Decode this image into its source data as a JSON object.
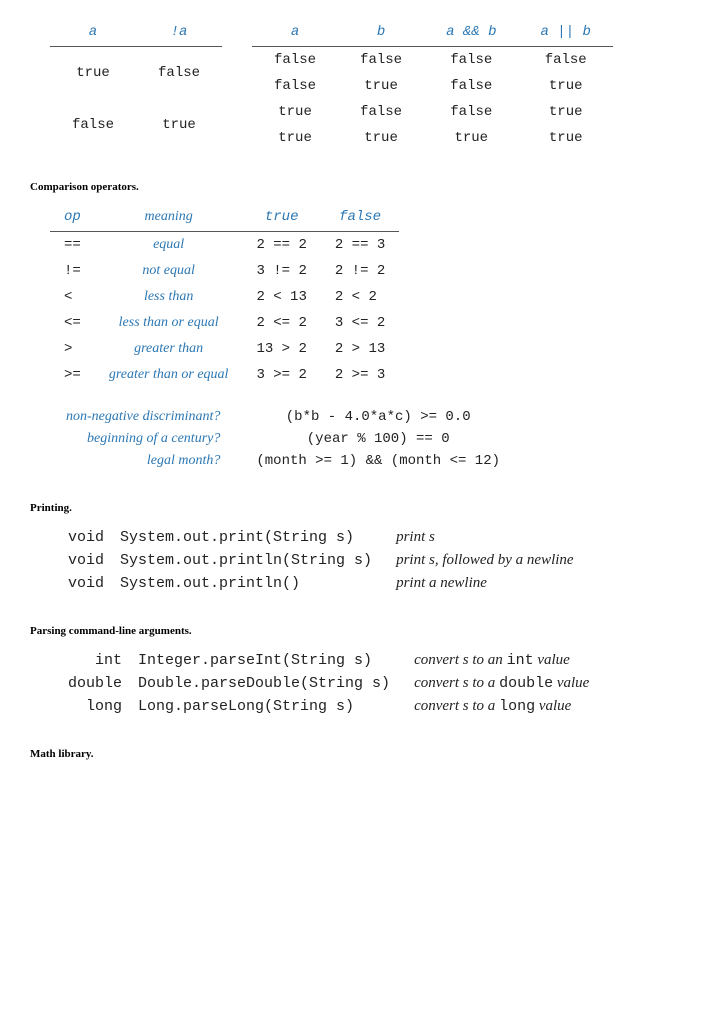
{
  "truth_not": {
    "headers": [
      "a",
      "!a"
    ],
    "rows": [
      [
        "true",
        "false"
      ],
      [
        "false",
        "true"
      ]
    ]
  },
  "truth_andor": {
    "headers": [
      "a",
      "b",
      "a && b",
      "a || b"
    ],
    "rows": [
      [
        "false",
        "false",
        "false",
        "false"
      ],
      [
        "false",
        "true",
        "false",
        "true"
      ],
      [
        "true",
        "false",
        "false",
        "true"
      ],
      [
        "true",
        "true",
        "true",
        "true"
      ]
    ]
  },
  "sections": {
    "comparison": "Comparison operators.",
    "printing": "Printing.",
    "parsing": "Parsing command-line arguments.",
    "math": "Math library."
  },
  "cmp": {
    "headers": {
      "op": "op",
      "meaning": "meaning",
      "true": "true",
      "false": "false"
    },
    "rows": [
      {
        "op": "==",
        "meaning": "equal",
        "t": "2 == 2",
        "f": "2 == 3"
      },
      {
        "op": "!=",
        "meaning": "not equal",
        "t": "3 != 2",
        "f": "2 != 2"
      },
      {
        "op": "<",
        "meaning": "less than",
        "t": "2 < 13",
        "f": "2 < 2"
      },
      {
        "op": "<=",
        "meaning": "less than or equal",
        "t": "2 <= 2",
        "f": "3 <= 2"
      },
      {
        "op": ">",
        "meaning": "greater than",
        "t": "13 > 2",
        "f": "2 > 13"
      },
      {
        "op": ">=",
        "meaning": "greater than or equal",
        "t": "3 >= 2",
        "f": "2 >= 3"
      }
    ]
  },
  "examples": [
    {
      "q": "non-negative discriminant?",
      "a": "(b*b - 4.0*a*c) >= 0.0"
    },
    {
      "q": "beginning of a century?",
      "a": "(year % 100) == 0"
    },
    {
      "q": "legal month?",
      "a": "(month >= 1) && (month <= 12)"
    }
  ],
  "printing": [
    {
      "ret": "void",
      "sig": "System.out.print(String s)",
      "desc_pre": "print ",
      "desc_ital": "s",
      "desc_post": ""
    },
    {
      "ret": "void",
      "sig": "System.out.println(String s)",
      "desc_pre": "print ",
      "desc_ital": "s",
      "desc_post": ", followed by a newline"
    },
    {
      "ret": "void",
      "sig": "System.out.println()",
      "desc_pre": "print a newline",
      "desc_ital": "",
      "desc_post": ""
    }
  ],
  "parsing": [
    {
      "ret": "int",
      "sig": "Integer.parseInt(String s)",
      "d1": "convert ",
      "di": "s",
      "d2": " to an ",
      "dm": "int",
      "d3": " value"
    },
    {
      "ret": "double",
      "sig": "Double.parseDouble(String s)",
      "d1": "convert ",
      "di": "s",
      "d2": " to a ",
      "dm": "double",
      "d3": " value"
    },
    {
      "ret": "long",
      "sig": "Long.parseLong(String s)",
      "d1": "convert ",
      "di": "s",
      "d2": " to a ",
      "dm": "long",
      "d3": " value"
    }
  ]
}
